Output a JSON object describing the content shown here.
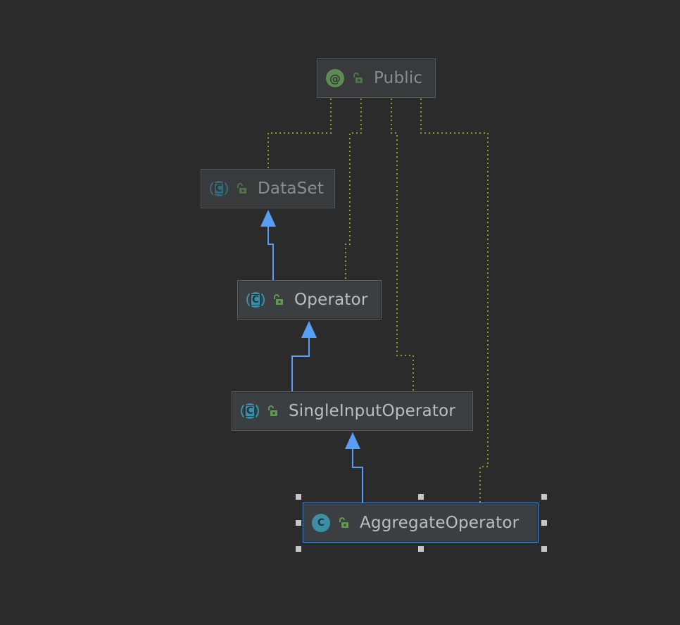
{
  "nodes": {
    "public": {
      "label": "Public",
      "kind": "annotation",
      "icon": "annotation-icon",
      "glyph": "@"
    },
    "dataset": {
      "label": "DataSet",
      "kind": "abstract-class",
      "icon": "abstract-class-icon",
      "glyph": "C"
    },
    "operator": {
      "label": "Operator",
      "kind": "abstract-class",
      "icon": "abstract-class-icon",
      "glyph": "C"
    },
    "single_input_operator": {
      "label": "SingleInputOperator",
      "kind": "abstract-class",
      "icon": "abstract-class-icon",
      "glyph": "C"
    },
    "aggregate_operator": {
      "label": "AggregateOperator",
      "kind": "class",
      "icon": "class-icon",
      "glyph": "C"
    }
  },
  "edges": [
    {
      "from": "dataset",
      "to": "operator",
      "type": "extends"
    },
    {
      "from": "operator",
      "to": "single_input_operator",
      "type": "extends"
    },
    {
      "from": "single_input_operator",
      "to": "aggregate_operator",
      "type": "extends"
    },
    {
      "from": "public",
      "to": "dataset",
      "type": "annotation"
    },
    {
      "from": "public",
      "to": "operator",
      "type": "annotation"
    },
    {
      "from": "public",
      "to": "single_input_operator",
      "type": "annotation"
    },
    {
      "from": "public",
      "to": "aggregate_operator",
      "type": "annotation"
    }
  ],
  "selected": "aggregate_operator",
  "colors": {
    "background": "#2b2b2b",
    "node_fill": "#3c3f41",
    "inheritance_edge": "#589df6",
    "annotation_edge": "#8c9c24",
    "class_icon": "#3d8fa8",
    "annotation_icon": "#5d8a55",
    "access_icon": "#5f9a4f",
    "selection": "#4a8ad4"
  }
}
